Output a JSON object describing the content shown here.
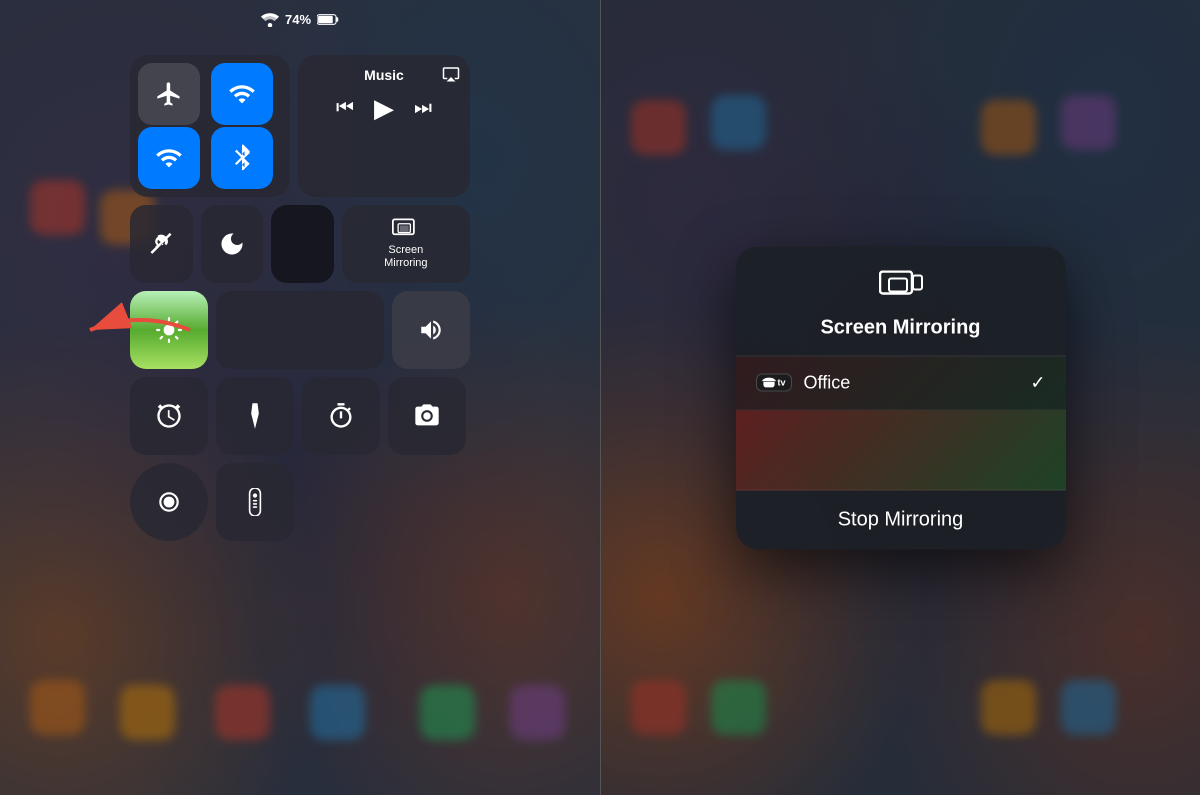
{
  "status_bar": {
    "wifi": "📶",
    "battery": "74%",
    "battery_icon": "🔋"
  },
  "left_panel": {
    "control_center": {
      "connectivity": {
        "airplane_mode": "✈",
        "cellular": "📡",
        "wifi": "📶",
        "bluetooth": "🔷"
      },
      "music_widget": {
        "title": "Music",
        "airplay_icon": "📺",
        "prev": "⏮",
        "play": "▶",
        "next": "⏭"
      },
      "controls": {
        "orientation_lock": "🔒",
        "do_not_disturb": "🌙",
        "screen_mirror_label": "Screen\nMirroring",
        "brightness_label": "Brightness",
        "volume_label": "Volume"
      },
      "bottom_controls": {
        "alarm": "🔔",
        "flashlight": "🔦",
        "timer": "⏱",
        "camera": "📷"
      },
      "last_controls": {
        "record": "⏺",
        "remote": "🖲"
      }
    }
  },
  "right_panel": {
    "mirroring_popup": {
      "title": "Screen Mirroring",
      "device": {
        "label": "tv",
        "name": "Office",
        "selected": true
      },
      "stop_button": "Stop Mirroring"
    }
  }
}
